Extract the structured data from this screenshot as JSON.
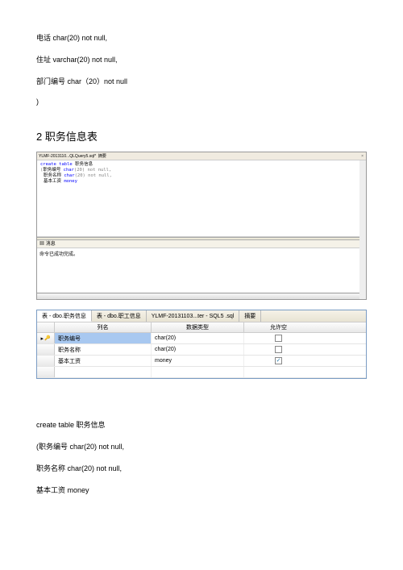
{
  "topLines": {
    "l1": "电话 char(20) not null,",
    "l2": "住址 varchar(20) not null,",
    "l3": "部门编号 char（20）not null",
    "l4": ")"
  },
  "heading": "2 职务信息表",
  "sqlEditor": {
    "tabTitle": "YLMF-2013110...QLQuery5.sql*",
    "tabSide": "摘要",
    "closeX": "×",
    "code": {
      "line1_kw1": "create",
      "line1_kw2": "table",
      "line1_name": "职务信息",
      "line2_open": "(",
      "line2_col": "职务编号",
      "line2_type": "char",
      "line2_args": "(20)",
      "line2_nn": "not null,",
      "line3_col": "职务名称",
      "line3_type": "char",
      "line3_args": "(20)",
      "line3_nn": "not null,",
      "line4_col": "基本工资",
      "line4_type": "money"
    },
    "messagesHeader": "消息",
    "messagesIcon": "▦",
    "messageText": "命令已成功完成。"
  },
  "tableDesigner": {
    "tabs": {
      "t1": "表 - dbo.职务信息",
      "t2": "表 - dbo.职工信息",
      "t3": "YLMF-20131103...ter - SQL5 .sql",
      "t4": "摘要"
    },
    "headers": {
      "colName": "列名",
      "dataType": "数据类型",
      "allowNull": "允许空"
    },
    "rows": [
      {
        "name": "职务编号",
        "type": "char(20)",
        "nullChecked": false,
        "isKey": true
      },
      {
        "name": "职务名称",
        "type": "char(20)",
        "nullChecked": false,
        "isKey": false
      },
      {
        "name": "基本工资",
        "type": "money",
        "nullChecked": true,
        "isKey": false
      }
    ]
  },
  "bottomCode": {
    "l1": "create table 职务信息",
    "l2": "(职务编号 char(20) not null,",
    "l3": " 职务名称 char(20) not null,",
    "l4": "基本工资 money"
  }
}
